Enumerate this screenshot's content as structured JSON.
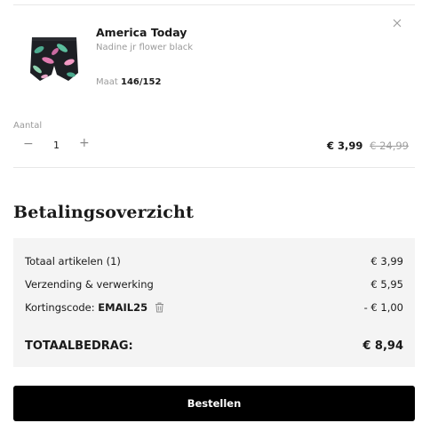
{
  "cart_item": {
    "brand": "America Today",
    "variant": "Nadine jr flower black",
    "size_label": "Maat",
    "size_value": "146/152",
    "remove_icon": "close-icon",
    "quantity_label": "Aantal",
    "quantity_minus": "−",
    "quantity_value": "1",
    "quantity_plus": "+",
    "price_current": "€ 3,99",
    "price_old": "€ 24,99"
  },
  "summary": {
    "title": "Betalingsoverzicht",
    "rows": [
      {
        "label": "Totaal artikelen (1)",
        "value": "€ 3,99"
      },
      {
        "label": "Verzending & verwerking",
        "value": "€ 5,95"
      },
      {
        "label": "Kortingscode:",
        "code": "EMAIL25",
        "value": "- € 1,00",
        "icon": "trash-icon"
      }
    ],
    "total_label": "TOTAALBEDRAG:",
    "total_value": "€ 8,94"
  },
  "checkout": {
    "button_label": "Bestellen"
  },
  "colors": {
    "button_bg": "#000000",
    "summary_bg": "#f4f4f4",
    "muted_text": "#9a9a9a"
  }
}
